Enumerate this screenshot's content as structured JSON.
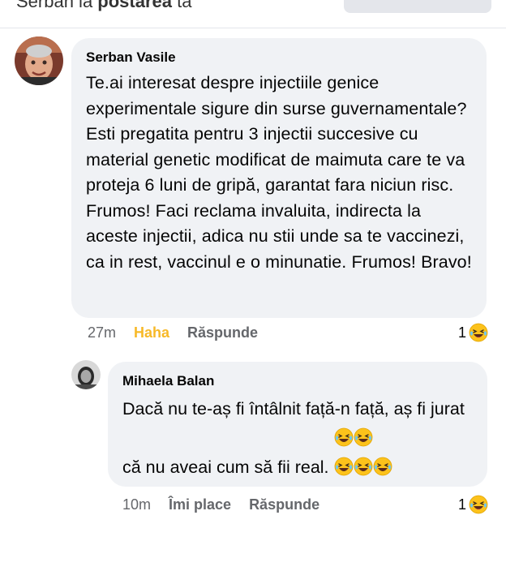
{
  "header": {
    "prefix": "Serban la ",
    "bold": "postarea",
    "suffix": " ta"
  },
  "comment": {
    "author": "Serban Vasile",
    "text": "Te.ai interesat despre injectiile genice experimentale sigure din surse guvernamentale? Esti pregatita pentru 3 injectii succesive cu material genetic modificat de maimuta care te va proteja 6 luni de gripă, garantat fara niciun risc. Frumos! Faci reclama invaluita, indirecta la aceste injectii, adica nu stii unde sa te vaccinezi, ca in rest, vaccinul e o minunatie. Frumos! Bravo!",
    "time": "27m",
    "reaction_label": "Haha",
    "reply_label": "Răspunde",
    "reaction_count": "1",
    "reaction_icon": "laughing-emoji-icon"
  },
  "reply": {
    "author": "Mihaela Balan",
    "text": "Dacă nu te-aș fi întâlnit față-n față, aș fi jurat că nu aveai cum să fii real.",
    "time": "10m",
    "like_label": "Îmi place",
    "reply_label": "Răspunde",
    "reaction_count": "1",
    "reaction_icon": "laughing-emoji-icon"
  },
  "colors": {
    "bubble": "#f0f2f5",
    "meta_text": "#65676b",
    "haha": "#f7b928"
  }
}
